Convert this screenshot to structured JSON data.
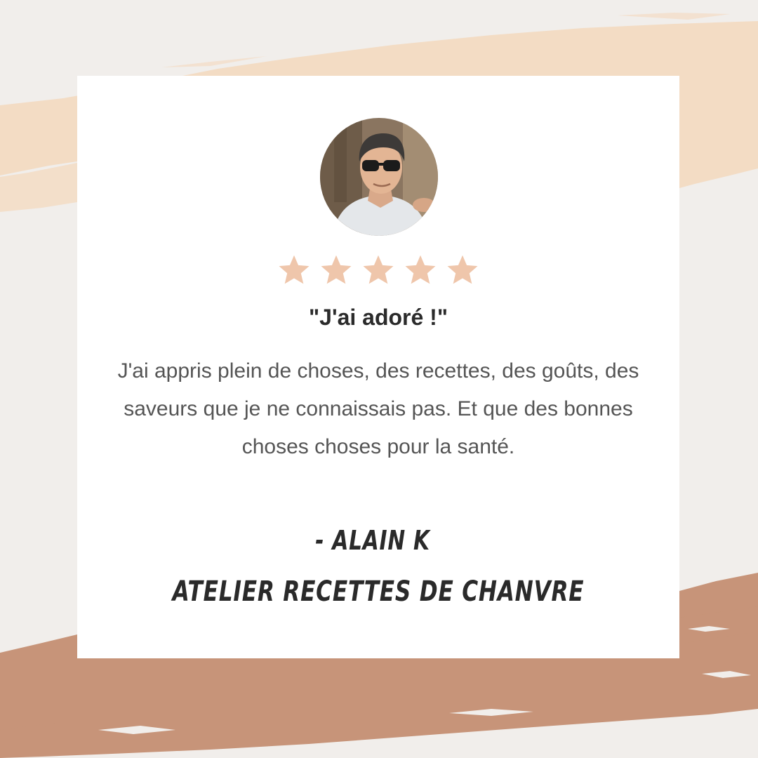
{
  "testimonial": {
    "rating": 5,
    "star_color": "#efc6ab",
    "headline": "\"J'ai adoré !\"",
    "body": "J'ai appris plein de choses, des recettes, des goûts, des saveurs que je ne connaissais pas. Et que des bonnes choses choses pour la santé.",
    "author": "- ALAIN K",
    "workshop": "ATELIER RECETTES DE CHANVRE"
  },
  "colors": {
    "background": "#f1eeeb",
    "brush_light": "#f3dcc4",
    "brush_dark": "#c79479",
    "card": "#ffffff",
    "headline": "#2b2b2b",
    "body_text": "#555555"
  },
  "avatar": {
    "icon": "person-photo"
  }
}
